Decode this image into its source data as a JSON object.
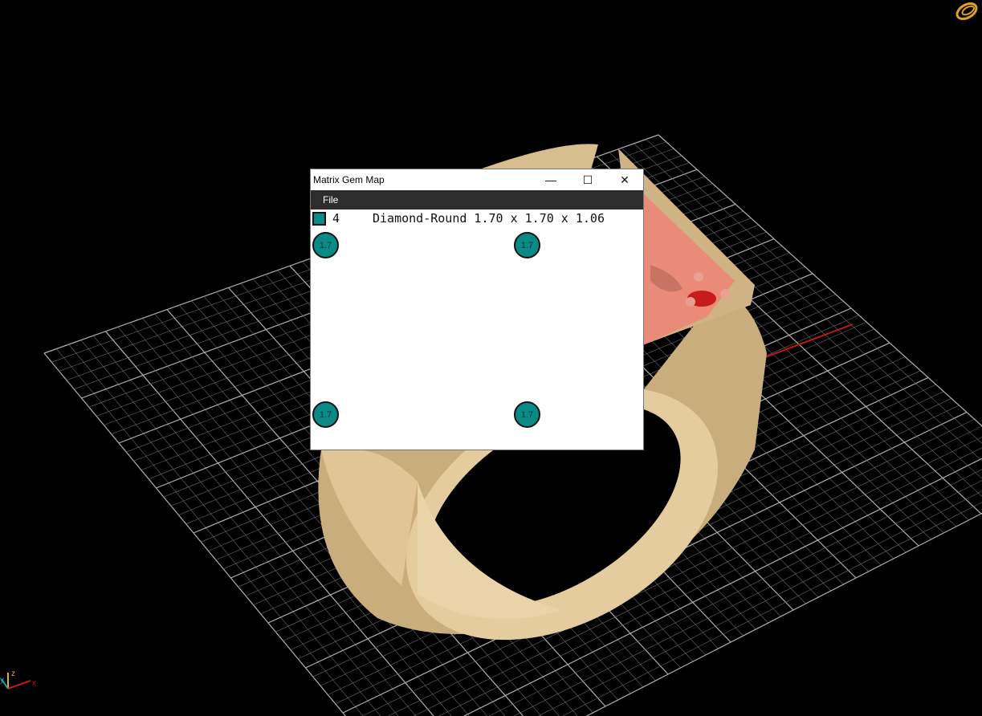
{
  "window": {
    "title": "Matrix Gem Map",
    "minimize": "—",
    "maximize": "☐",
    "close": "✕"
  },
  "menu": {
    "file": "File"
  },
  "gem_summary": {
    "count": "4",
    "description": "Diamond-Round 1.70 x 1.70 x 1.06",
    "color": "#0a8a86"
  },
  "gems": [
    {
      "label": "1.7"
    },
    {
      "label": "1.7"
    },
    {
      "label": "1.7"
    },
    {
      "label": "1.7"
    }
  ],
  "axes": {
    "x": "x",
    "y": "y",
    "z": "z"
  },
  "colors": {
    "ring": "#d8bd8e",
    "ring_shadow": "#8a7650",
    "face": "#e98b78",
    "grid": "#9a9a9a",
    "x_axis": "#c01818"
  }
}
